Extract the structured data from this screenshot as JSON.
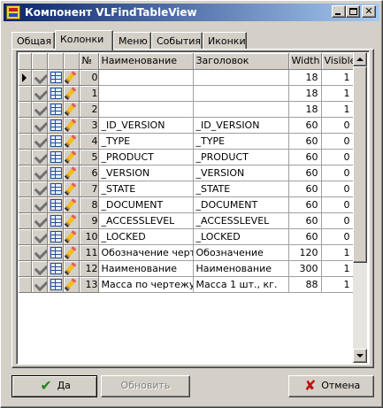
{
  "window": {
    "title": "Компонент VLFindTableView",
    "min_glyph": "",
    "max_glyph": "",
    "close_glyph": "✕"
  },
  "tabs": [
    {
      "label": "Общая",
      "active": false
    },
    {
      "label": "Колонки",
      "active": true
    },
    {
      "label": "Меню",
      "active": false
    },
    {
      "label": "События",
      "active": false
    },
    {
      "label": "Иконки",
      "active": false
    }
  ],
  "grid": {
    "headers": {
      "num": "№",
      "name": "Наименование",
      "caption": "Заголовок",
      "width": "Width",
      "visible": "Visible"
    },
    "rows": [
      {
        "num": "0",
        "name": "",
        "caption": "",
        "width": "18",
        "visible": "1"
      },
      {
        "num": "1",
        "name": "",
        "caption": "",
        "width": "18",
        "visible": "1"
      },
      {
        "num": "2",
        "name": "",
        "caption": "",
        "width": "18",
        "visible": "1"
      },
      {
        "num": "3",
        "name": "_ID_VERSION",
        "caption": "_ID_VERSION",
        "width": "60",
        "visible": "0"
      },
      {
        "num": "4",
        "name": "_TYPE",
        "caption": "_TYPE",
        "width": "60",
        "visible": "0"
      },
      {
        "num": "5",
        "name": "_PRODUCT",
        "caption": "_PRODUCT",
        "width": "60",
        "visible": "0"
      },
      {
        "num": "6",
        "name": "_VERSION",
        "caption": "_VERSION",
        "width": "60",
        "visible": "0"
      },
      {
        "num": "7",
        "name": "_STATE",
        "caption": "_STATE",
        "width": "60",
        "visible": "0"
      },
      {
        "num": "8",
        "name": "_DOCUMENT",
        "caption": "_DOCUMENT",
        "width": "60",
        "visible": "0"
      },
      {
        "num": "9",
        "name": "_ACCESSLEVEL",
        "caption": "_ACCESSLEVEL",
        "width": "60",
        "visible": "0"
      },
      {
        "num": "10",
        "name": "_LOCKED",
        "caption": "_LOCKED",
        "width": "60",
        "visible": "0"
      },
      {
        "num": "11",
        "name": "Обозначение чертеж",
        "caption": "Обозначение",
        "width": "120",
        "visible": "1"
      },
      {
        "num": "12",
        "name": "Наименование",
        "caption": "Наименование",
        "width": "300",
        "visible": "1"
      },
      {
        "num": "13",
        "name": "Масса по чертежу",
        "caption": "Масса 1 шт., кг.",
        "width": "88",
        "visible": "1"
      }
    ],
    "row_icons": [
      "checkmark-icon",
      "table-icon",
      "pencil-icon"
    ]
  },
  "buttons": {
    "ok": "Да",
    "refresh": "Обновить",
    "cancel": "Отмена"
  }
}
